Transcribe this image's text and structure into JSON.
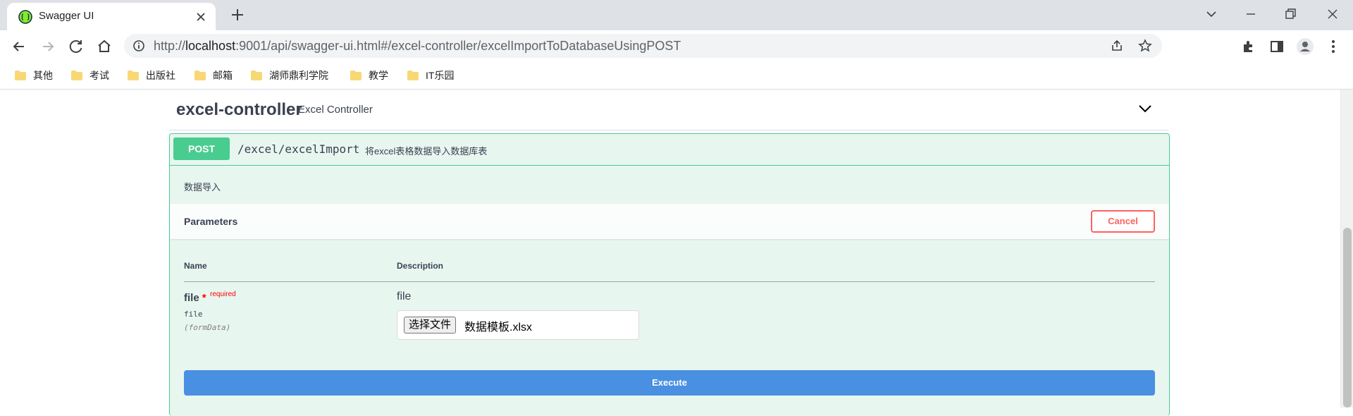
{
  "browser": {
    "tab": {
      "title": "Swagger UI"
    },
    "url": {
      "scheme": "http://",
      "host": "localhost",
      "rest": ":9001/api/swagger-ui.html#/excel-controller/excelImportToDatabaseUsingPOST"
    },
    "bookmarks": [
      {
        "label": "其他"
      },
      {
        "label": "考试"
      },
      {
        "label": "出版社"
      },
      {
        "label": "邮箱"
      },
      {
        "label": "湖师鼎利学院"
      },
      {
        "label": "教学"
      },
      {
        "label": "IT乐园"
      }
    ],
    "colors": {
      "tabstrip": "#dee1e6",
      "omnibox": "#f1f3f4",
      "folder": "#f8d775"
    }
  },
  "section": {
    "title": "excel-controller",
    "description": "Excel Controller"
  },
  "operation": {
    "method": "POST",
    "path": "/excel/excelImport",
    "summary": "将excel表格数据导入数据库表",
    "description": "数据导入",
    "colors": {
      "accent": "#49cc90",
      "background": "#e8f6f0"
    }
  },
  "parameters": {
    "title": "Parameters",
    "cancel_label": "Cancel",
    "columns": {
      "name": "Name",
      "description": "Description"
    },
    "items": [
      {
        "name": "file",
        "required_star": "*",
        "required_label": "required",
        "type": "file",
        "in": "(formData)",
        "description": "file",
        "file_button_label": "选择文件",
        "file_name": "数据模板.xlsx"
      }
    ]
  },
  "execute": {
    "label": "Execute",
    "color": "#4990e2"
  }
}
